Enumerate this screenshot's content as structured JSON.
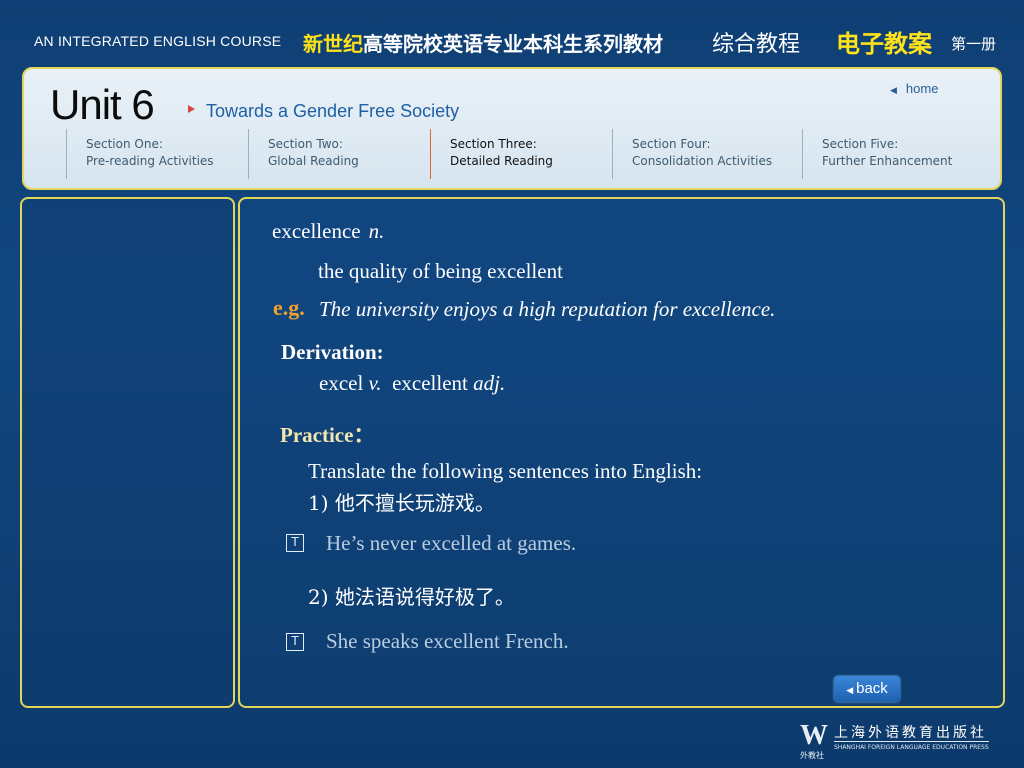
{
  "banner": {
    "course_en": "AN INTEGRATED ENGLISH COURSE",
    "cn_highlight": "新世纪",
    "cn_rest": "高等院校英语专业本科生系列教材",
    "cn_textbook": "综合教程",
    "cn_ecase": "电子教案",
    "cn_volume": "第一册"
  },
  "header": {
    "unit": "Unit 6",
    "subtitle": "Towards a Gender Free Society",
    "home_label": "home",
    "sections": [
      {
        "title": "Section One:",
        "name": "Pre-reading Activities"
      },
      {
        "title": "Section Two:",
        "name": "Global Reading"
      },
      {
        "title": "Section Three:",
        "name": "Detailed Reading"
      },
      {
        "title": "Section Four:",
        "name": "Consolidation Activities"
      },
      {
        "title": "Section Five:",
        "name": "Further Enhancement"
      }
    ]
  },
  "content": {
    "word": "excellence",
    "pos": "n.",
    "definition": "the quality of being excellent",
    "eg_label": "e.g.",
    "example": "The university enjoys a high reputation for excellence.",
    "derivation_heading": "Derivation:",
    "deriv_word1": "excel",
    "deriv_pos1": "v.",
    "deriv_word2": "excellent",
    "deriv_pos2": "adj.",
    "practice_heading": "Practice：",
    "instruction": "Translate the following sentences into English:",
    "q1": "1) 他不擅长玩游戏。",
    "a1": "He’s never excelled at games.",
    "q2": "2) 她法语说得好极了。",
    "a2": "She speaks excellent French.",
    "toggle_glyph": "T"
  },
  "nav": {
    "back_label": "back"
  },
  "publisher": {
    "logo": "W",
    "logo_sub": "外教社",
    "name_cn": "上海外语教育出版社",
    "name_en": "SHANGHAI FOREIGN LANGUAGE EDUCATION PRESS"
  }
}
